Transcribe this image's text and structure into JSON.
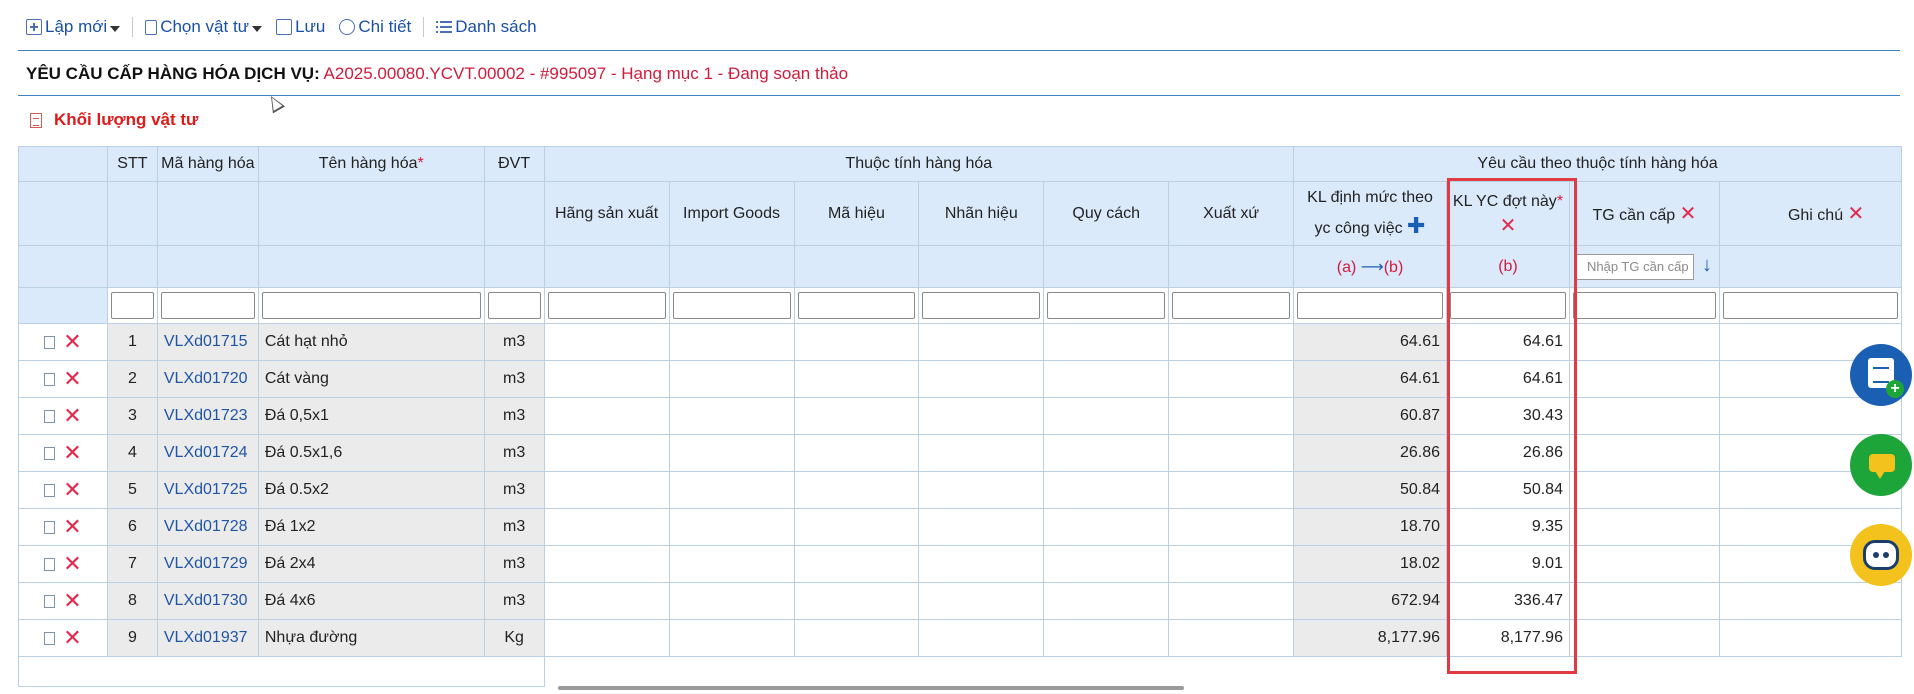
{
  "toolbar": {
    "new_label": "Lập mới",
    "select_label": "Chọn vật tư",
    "save_label": "Lưu",
    "detail_label": "Chi tiết",
    "list_label": "Danh sách"
  },
  "title": {
    "label": "YÊU CẦU CẤP HÀNG HÓA DỊCH VỤ:",
    "value": "A2025.00080.YCVT.00002 - #995097 - Hạng mục 1 - Đang soạn thảo"
  },
  "section": {
    "title": "Khối lượng vật tư"
  },
  "grid": {
    "headers": {
      "stt": "STT",
      "code": "Mã hàng hóa",
      "name": "Tên hàng hóa",
      "name_required": "*",
      "unit": "ĐVT",
      "group_attrs": "Thuộc tính hàng hóa",
      "group_req": "Yêu cầu theo thuộc tính hàng hóa",
      "manufacturer": "Hãng sản xuất",
      "import_goods": "Import Goods",
      "model": "Mã hiệu",
      "brand": "Nhãn hiệu",
      "spec": "Quy cách",
      "origin": "Xuất xứ",
      "kl_norm_line1": "KL định mức theo",
      "kl_norm_line2": "yc công việc",
      "kl_req": "KL YC đợt này",
      "kl_req_required": "*",
      "tg": "TG cần cấp",
      "note": "Ghi chú",
      "a_to_b_a": "(a)",
      "a_to_b_b": "(b)",
      "b_label": "(b)",
      "tg_placeholder": "Nhập TG cần cấp"
    },
    "rows": [
      {
        "stt": "1",
        "code": "VLXd01715",
        "name": "Cát hạt nhỏ",
        "unit": "m3",
        "kl_norm": "64.61",
        "kl_req": "64.61"
      },
      {
        "stt": "2",
        "code": "VLXd01720",
        "name": "Cát vàng",
        "unit": "m3",
        "kl_norm": "64.61",
        "kl_req": "64.61"
      },
      {
        "stt": "3",
        "code": "VLXd01723",
        "name": "Đá 0,5x1",
        "unit": "m3",
        "kl_norm": "60.87",
        "kl_req": "30.43"
      },
      {
        "stt": "4",
        "code": "VLXd01724",
        "name": "Đá 0.5x1,6",
        "unit": "m3",
        "kl_norm": "26.86",
        "kl_req": "26.86"
      },
      {
        "stt": "5",
        "code": "VLXd01725",
        "name": "Đá 0.5x2",
        "unit": "m3",
        "kl_norm": "50.84",
        "kl_req": "50.84"
      },
      {
        "stt": "6",
        "code": "VLXd01728",
        "name": "Đá 1x2",
        "unit": "m3",
        "kl_norm": "18.70",
        "kl_req": "9.35"
      },
      {
        "stt": "7",
        "code": "VLXd01729",
        "name": "Đá 2x4",
        "unit": "m3",
        "kl_norm": "18.02",
        "kl_req": "9.01"
      },
      {
        "stt": "8",
        "code": "VLXd01730",
        "name": "Đá 4x6",
        "unit": "m3",
        "kl_norm": "672.94",
        "kl_req": "336.47"
      },
      {
        "stt": "9",
        "code": "VLXd01937",
        "name": "Nhựa đường",
        "unit": "Kg",
        "kl_norm": "8,177.96",
        "kl_req": "8,177.96"
      }
    ]
  },
  "icons": {
    "copy": "copy-icon",
    "delete": "delete-icon",
    "fab1": "clipboard-add-icon",
    "fab2": "chat-icon",
    "fab3": "robot-support-icon"
  },
  "colors": {
    "accent": "#1a4fa8",
    "header_bg": "#dbeafb",
    "readonly_bg": "#ebebeb",
    "required": "#d7193b",
    "highlight_border": "#e03a45"
  }
}
